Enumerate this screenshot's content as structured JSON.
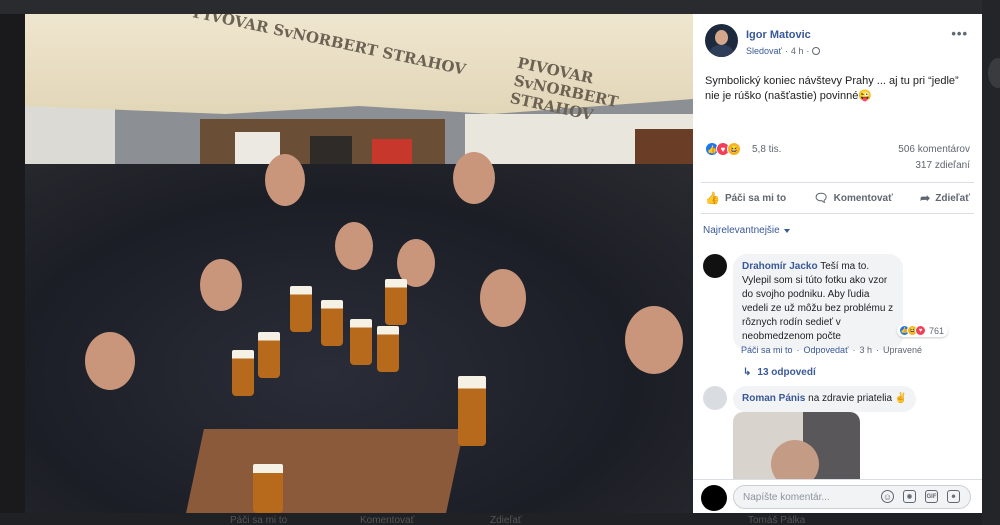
{
  "background": {
    "ghost_bottom": [
      "Páči sa mi to",
      "Komentovať",
      "Zdieľať"
    ],
    "ghost_right_name": "Tomáš Pálka"
  },
  "photo": {
    "umbrella_logo_1": "PIVOVAR SvNORBERT STRAHOV",
    "umbrella_logo_2": "PIVOVAR SvNORBERT STRAHOV"
  },
  "post": {
    "author": "Igor Matovic",
    "follow": "Sledovať",
    "time": "4 h",
    "text": "Symbolický koniec návštevy Prahy ... aj tu pri “jedle” nie je rúško (našťastie) povinné😜",
    "reaction_count": "5,8 tis.",
    "comments_count": "506 komentárov",
    "shares_count": "317 zdieľaní",
    "reactions": [
      "like",
      "love",
      "haha"
    ]
  },
  "actions": {
    "like": "Páči sa mi to",
    "comment": "Komentovať",
    "share": "Zdieľať"
  },
  "sort_label": "Najrelevantnejšie",
  "comments": [
    {
      "name": "Drahomír Jacko",
      "text": "Teší ma to. Vylepil som si túto fotku ako vzor do svojho podniku. Aby ľudia vedeli ze už môžu bez problému z rôznych rodín sedieť v neobmedzenom počte",
      "reaction_count": "761",
      "like_label": "Páči sa mi to",
      "reply_label": "Odpovedať",
      "time": "3 h",
      "edited": "Upravené",
      "replies": "13 odpovedí"
    },
    {
      "name": "Roman Pánis",
      "text": "na zdravie priatelia ✌️"
    }
  ],
  "composer": {
    "placeholder": "Napíšte komentár..."
  }
}
